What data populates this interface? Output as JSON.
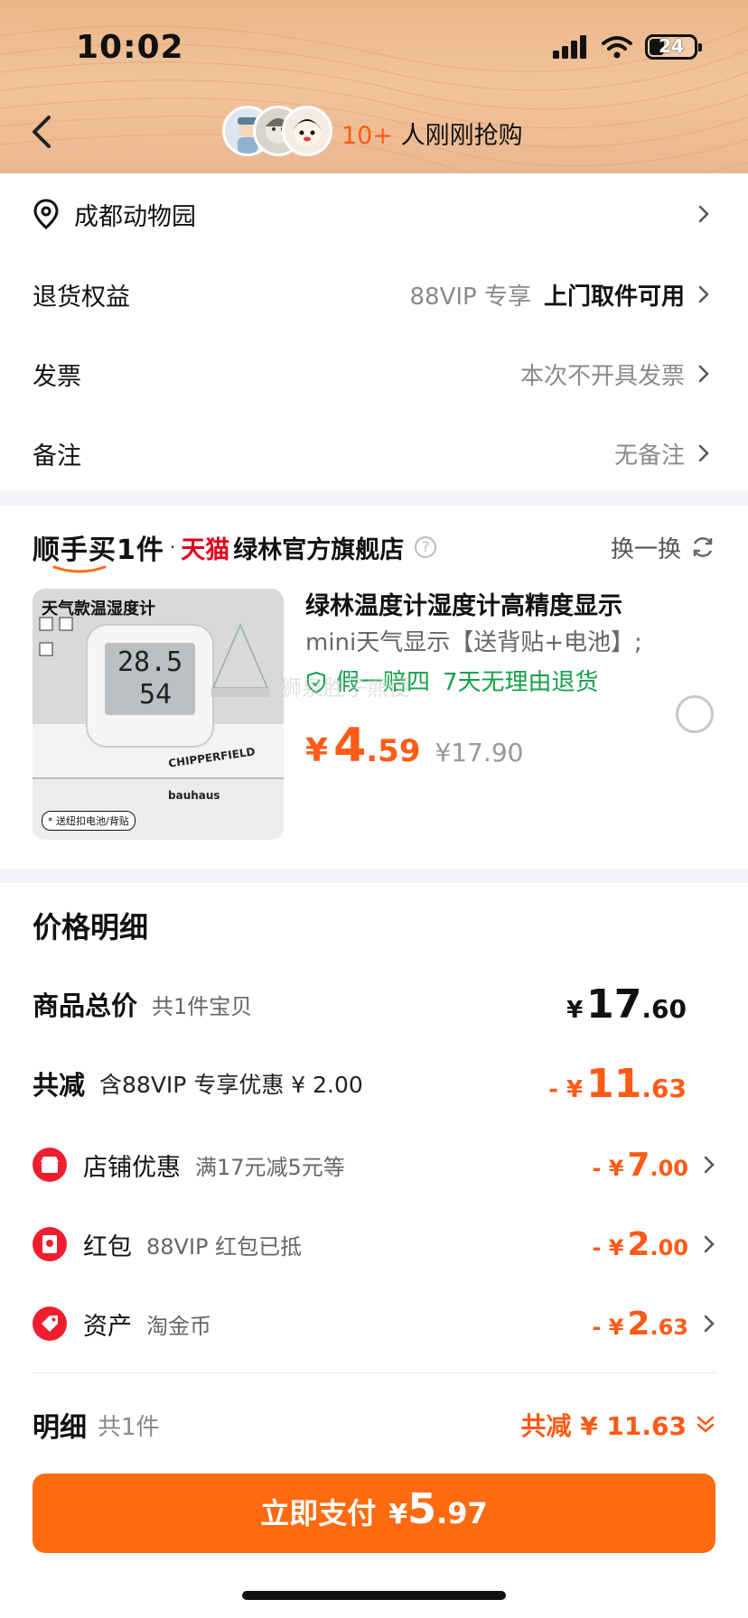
{
  "status_bar": {
    "time": "10:02",
    "battery": "24"
  },
  "header": {
    "buyers_count": "10+",
    "buyers_text": " 人刚刚抢购"
  },
  "order_rows": {
    "address": "成都动物园",
    "returns": {
      "label": "退货权益",
      "vip": "88VIP 专享",
      "value": "上门取件可用"
    },
    "invoice": {
      "label": "发票",
      "value": "本次不开具发票"
    },
    "note": {
      "label": "备注",
      "value": "无备注"
    }
  },
  "addon": {
    "brand_title": "顺手买1件",
    "dot": "·",
    "tmall": "天猫",
    "store": "绿林官方旗舰店",
    "swap_label": "换一换",
    "thumb_title": "天气款温湿度计",
    "thumb_caption": "* 送纽扣电池/背贴",
    "thumb_brand": "CHIPPERFIELD",
    "thumb_book": "bauhaus",
    "thumb_reading_temp": "28.5",
    "thumb_reading_hum": "54",
    "watermark": "狮泉胜子熊便",
    "product_title": "绿林温度计湿度计高精度显示",
    "product_sub": "mini天气显示【送背贴+电池】;",
    "badge_1": "假一赔四",
    "badge_2": "7天无理由退货",
    "price_yen": "¥",
    "price_int": "4",
    "price_dec": ".59",
    "orig_price": "¥17.90"
  },
  "price_details": {
    "title": "价格明细",
    "total": {
      "label": "商品总价",
      "sub": "共1件宝贝",
      "yen": "¥",
      "int": "17",
      "dec": ".60"
    },
    "discount": {
      "label": "共减",
      "sub": "含88VIP 专享优惠 ¥ 2.00",
      "yen": "- ¥",
      "int": "11",
      "dec": ".63"
    },
    "items": [
      {
        "label": "店铺优惠",
        "sub": "满17元减5元等",
        "yen": "- ¥",
        "int": "7",
        "dec": ".00"
      },
      {
        "label": "红包",
        "sub": "88VIP 红包已抵",
        "yen": "- ¥",
        "int": "2",
        "dec": ".00"
      },
      {
        "label": "资产",
        "sub": "淘金币",
        "yen": "- ¥",
        "int": "2",
        "dec": ".63"
      }
    ],
    "summary": {
      "label": "明细",
      "sub": "共1件",
      "total": "共减 ¥ 11.63"
    }
  },
  "pay_button": {
    "label": "立即支付",
    "yen": "¥",
    "int": "5",
    "dec": ".97"
  },
  "colors": {
    "accent": "#ff5a16",
    "pay": "#ff6a10",
    "tmall": "#e0001b",
    "guarantee": "#16a04a"
  }
}
